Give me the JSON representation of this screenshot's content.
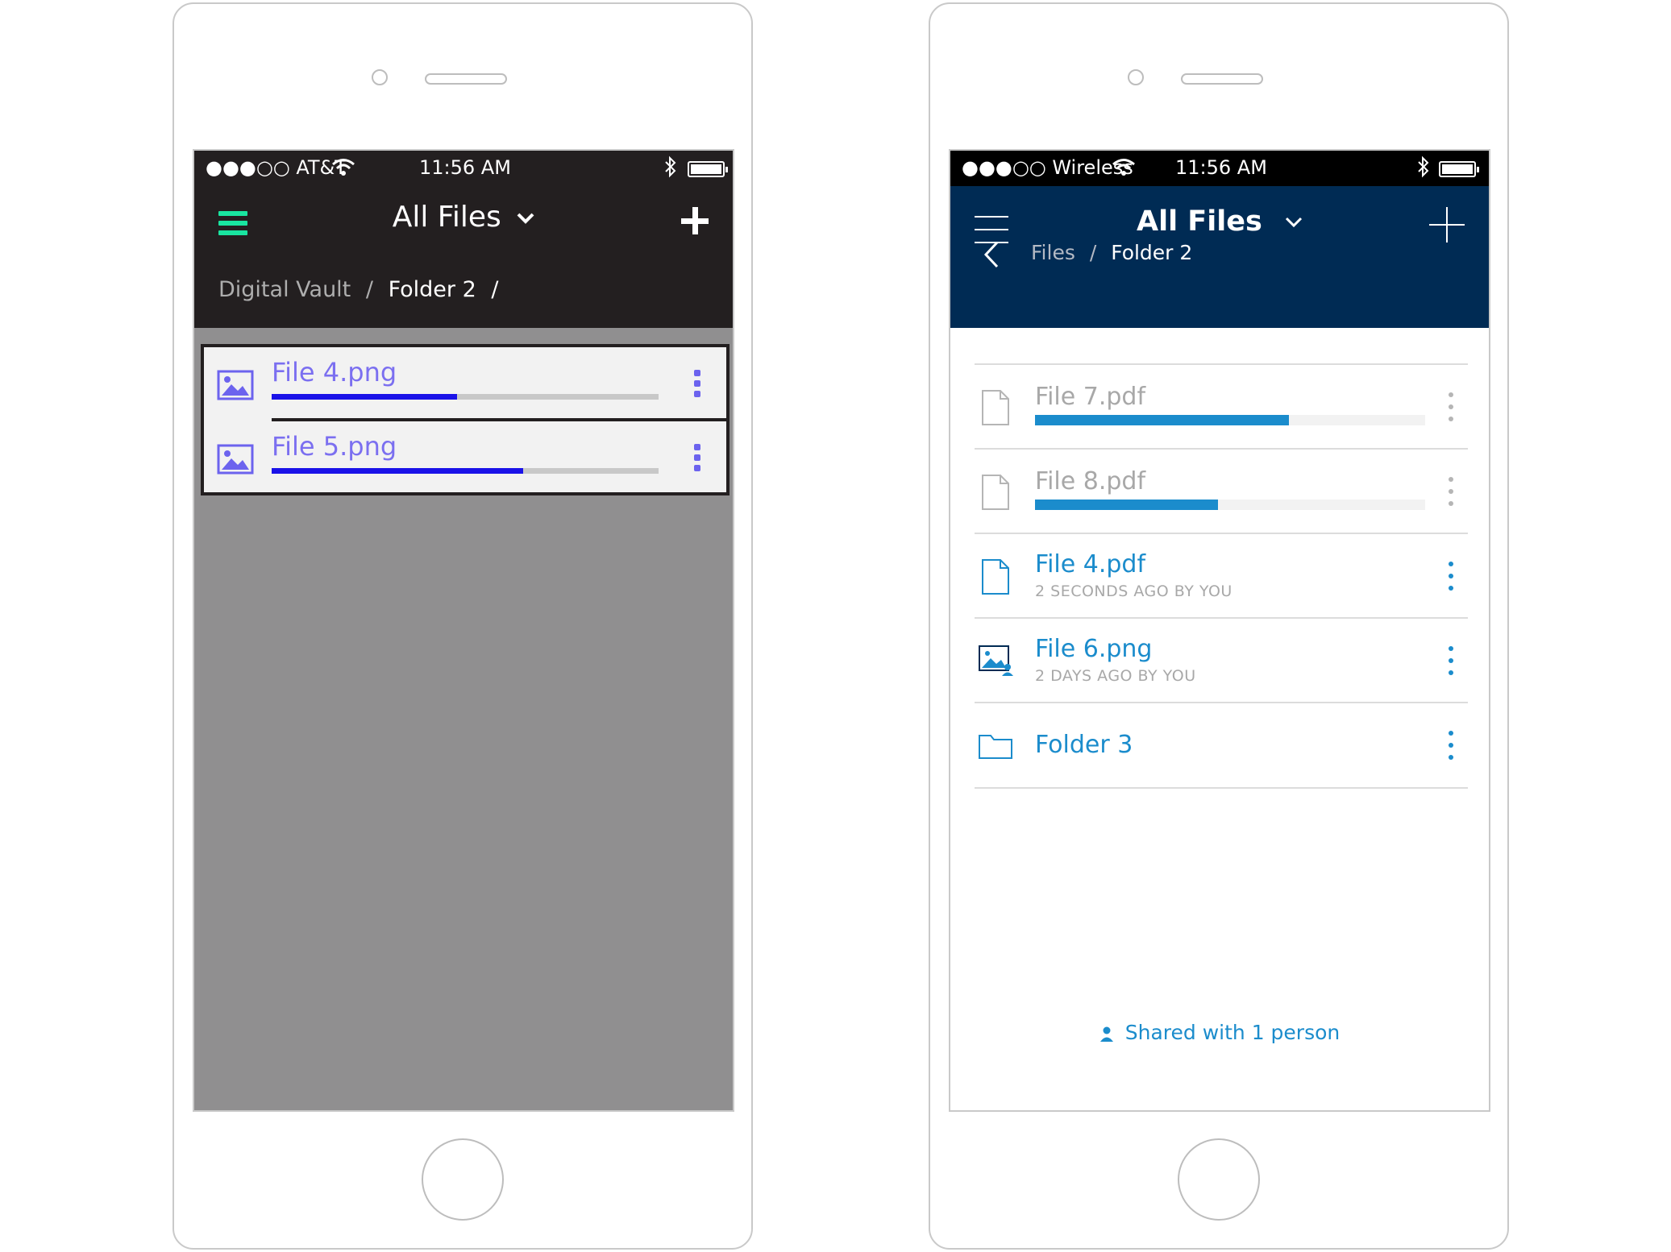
{
  "left_phone": {
    "status": {
      "carrier": "●●●○○ AT&T",
      "time": "11:56 AM"
    },
    "header": {
      "title": "All Files",
      "breadcrumb_root": "Digital Vault",
      "breadcrumb_sep": "/",
      "breadcrumb_current": "Folder 2",
      "breadcrumb_trail": "/"
    },
    "uploads": [
      {
        "name": "File 4.png",
        "progress": 0.48
      },
      {
        "name": "File 5.png",
        "progress": 0.65
      }
    ],
    "colors": {
      "accent_menu": "#19e5a0",
      "upload_text": "#7b6ff0",
      "progress": "#1a12e8",
      "header_bg": "#231f20",
      "body_bg": "#908f90"
    }
  },
  "right_phone": {
    "status": {
      "carrier": "●●●○○ Wireless",
      "time": "11:56 AM"
    },
    "header": {
      "title": "All Files",
      "breadcrumb_root": "Files",
      "breadcrumb_sep": "/",
      "breadcrumb_current": "Folder 2"
    },
    "files": [
      {
        "name": "File 7.pdf",
        "icon": "document-icon",
        "state": "uploading",
        "progress": 0.65
      },
      {
        "name": "File 8.pdf",
        "icon": "document-icon",
        "state": "uploading",
        "progress": 0.47
      },
      {
        "name": "File 4.pdf",
        "icon": "document-icon",
        "state": "done",
        "subtitle": "2 SECONDS AGO BY YOU"
      },
      {
        "name": "File 6.png",
        "icon": "shared-image-icon",
        "state": "done",
        "subtitle": "2 DAYS AGO BY YOU"
      },
      {
        "name": "Folder 3",
        "icon": "folder-icon",
        "state": "done"
      }
    ],
    "shared_label": "Shared with 1 person",
    "colors": {
      "header_bg": "#002b54",
      "accent": "#1b8ccc",
      "muted": "#a8a8a8"
    }
  }
}
